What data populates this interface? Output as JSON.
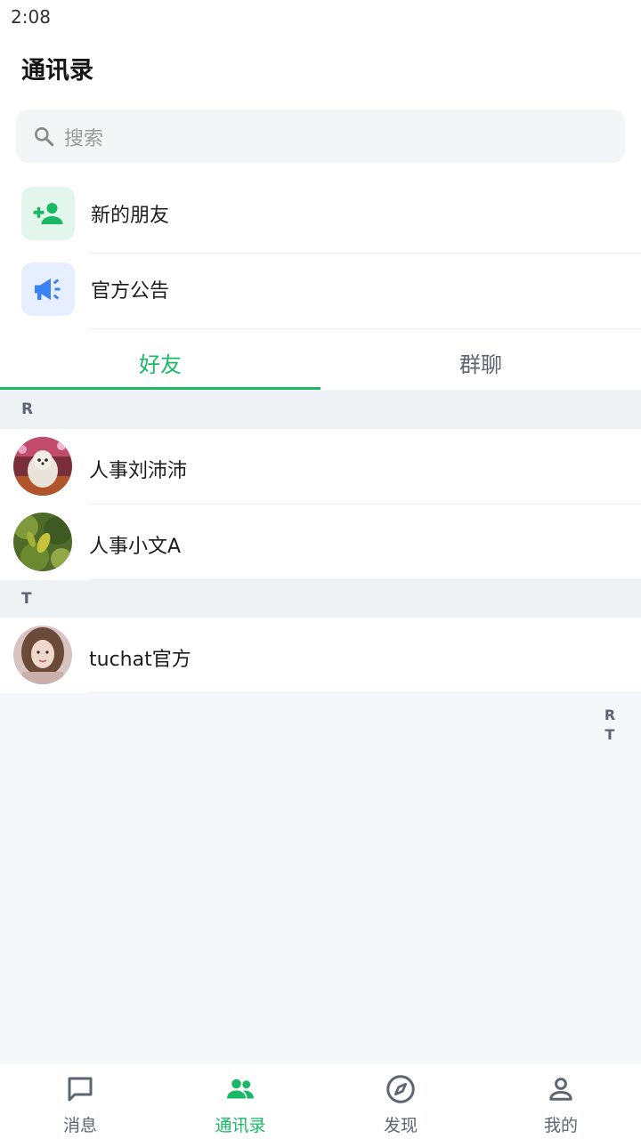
{
  "status": {
    "time": "2:08"
  },
  "header": {
    "title": "通讯录"
  },
  "search": {
    "placeholder": "搜索"
  },
  "entries": [
    {
      "label": "新的朋友",
      "icon": "person-add-icon"
    },
    {
      "label": "官方公告",
      "icon": "megaphone-icon"
    }
  ],
  "tabs": [
    {
      "label": "好友",
      "active": true
    },
    {
      "label": "群聊",
      "active": false
    }
  ],
  "sections": [
    {
      "letter": "R",
      "contacts": [
        {
          "name": "人事刘沛沛"
        },
        {
          "name": "人事小文A"
        }
      ]
    },
    {
      "letter": "T",
      "contacts": [
        {
          "name": "tuchat官方"
        }
      ]
    }
  ],
  "index": [
    "R",
    "T"
  ],
  "nav": [
    {
      "label": "消息",
      "icon": "chat-icon",
      "active": false
    },
    {
      "label": "通讯录",
      "icon": "contacts-icon",
      "active": true
    },
    {
      "label": "发现",
      "icon": "compass-icon",
      "active": false
    },
    {
      "label": "我的",
      "icon": "profile-icon",
      "active": false
    }
  ],
  "colors": {
    "accent": "#19b864",
    "secondary_text": "#5d6573",
    "announce_blue": "#3b82f6"
  }
}
